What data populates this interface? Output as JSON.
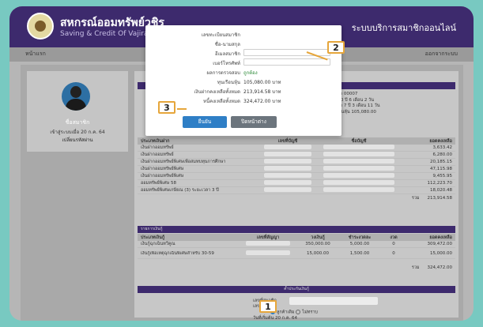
{
  "header": {
    "title_th": "สหกรณ์ออมทรัพย์วชิร",
    "title_en": "Saving & Credit Of Vajira",
    "right_label": "ระบบบริการสมาชิกออนไลน์"
  },
  "nav": {
    "left": "หน้าแรก",
    "right": "ออกจากระบบ"
  },
  "sidebar": {
    "name": "ชื่อสมาชิก",
    "date": "เข้าสู่ระบบเมื่อ 20 ก.ค. 64",
    "link": "เปลี่ยนรหัสผ่าน"
  },
  "summary": {
    "lines": [
      "สมาชิก 00007",
      "อายุ 30 ปี 6 เดือน 2 วัน",
      "สมาชิก 7 ปี 3 เดือน 11 วัน",
      "ทุนเรือนหุ้น 105,080.00"
    ]
  },
  "table1": {
    "headers": [
      "ประเภทเงินฝาก",
      "เลขที่บัญชี",
      "ชื่อบัญชี",
      "ยอดคงเหลือ"
    ],
    "rows": [
      {
        "type": "เงินฝากออมทรัพย์",
        "amount": "3,633.42"
      },
      {
        "type": "เงินฝากออมทรัพย์",
        "amount": "6,280.00"
      },
      {
        "type": "เงินฝากออมทรัพย์พิเศษเพื่อสมทบทุนการศึกษา",
        "amount": "20,185.15"
      },
      {
        "type": "เงินฝากออมทรัพย์พิเศษ",
        "amount": "47,115.98"
      },
      {
        "type": "เงินฝากออมทรัพย์พิเศษ",
        "amount": "9,455.95"
      },
      {
        "type": "ออมทรัพย์พิเศษ 58",
        "amount": "112,223.70"
      },
      {
        "type": "ออมทรัพย์พิเศษเกษียณ (3) ระยะเวลา 3 ปี",
        "amount": "18,020.48"
      }
    ],
    "total_label": "รวม",
    "total": "213,914.58"
  },
  "table2": {
    "section_title": "รายการเงินกู้",
    "headers": [
      "ประเภทเงินกู้",
      "เลขที่สัญญา",
      "วงเงินกู้",
      "ชำระงวดละ",
      "งวด",
      "ยอดคงเหลือ"
    ],
    "rows": [
      {
        "type": "เงินกู้ฉุกเฉินทวีคูณ",
        "limit": "350,000.00",
        "pay": "5,000.00",
        "period": "0",
        "balance": "309,472.00"
      },
      {
        "type": "เงินกู้เพื่อเหตุฉุกเฉินพิเศษสำหรับ 30-59",
        "limit": "15,000.00",
        "pay": "1,500.00",
        "period": "0",
        "balance": "15,000.00"
      }
    ],
    "total_label": "รวม",
    "total": "324,472.00"
  },
  "bottom": {
    "bar_label": "ค้ำประกันเงินกู้",
    "field1_label": "เลขที่สมาชิก",
    "field2_label": "เลขที่บัญชี",
    "radio_label1": "ลูกค้าเดิม",
    "radio_label2": "ไม่ทราบ",
    "date_label": "วันที่เริ่มต้น",
    "date_value": "20 ก.ค. 64"
  },
  "modal": {
    "fields": [
      {
        "label": "เลขทะเบียนสมาชิก",
        "value": ""
      },
      {
        "label": "ชื่อ-นามสกุล",
        "value": ""
      },
      {
        "label": "อีเมลสมาชิก",
        "value": "",
        "input": true
      },
      {
        "label": "เบอร์โทรศัพท์",
        "value": "",
        "input": true
      },
      {
        "label": "ผลการตรวจสอบ",
        "value": "ถูกต้อง",
        "green": true
      },
      {
        "label": "ทุนเรือนหุ้น",
        "value": "105,080.00 บาท"
      },
      {
        "label": "เงินฝากคงเหลือทั้งหมด",
        "value": "213,914.58 บาท"
      },
      {
        "label": "หนี้คงเหลือทั้งหมด",
        "value": "324,472.00 บาท"
      }
    ],
    "ok_label": "ยืนยัน",
    "back_label": "ปิดหน้าต่าง"
  },
  "callouts": [
    "1",
    "2",
    "3"
  ],
  "colors": {
    "header": "#3d2a6d",
    "background": "#78c9c1",
    "primary_button": "#2f7fc6",
    "callout_border": "#e6a63b"
  }
}
